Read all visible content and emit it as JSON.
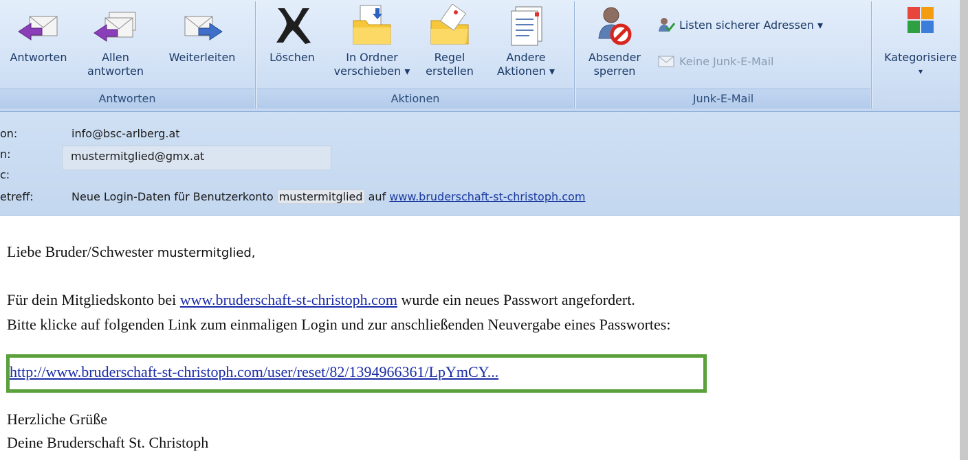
{
  "ribbon": {
    "groups": {
      "respond": {
        "caption": "Antworten"
      },
      "actions": {
        "caption": "Aktionen"
      },
      "junk": {
        "caption": "Junk-E-Mail"
      }
    },
    "reply_line1": "Antworten",
    "reply_all_line1": "Allen",
    "reply_all_line2": "antworten",
    "forward_line1": "Weiterleiten",
    "delete_line1": "Löschen",
    "move_line1": "In Ordner",
    "move_line2": "verschieben ▾",
    "rule_line1": "Regel",
    "rule_line2": "erstellen",
    "other_line1": "Andere",
    "other_line2": "Aktionen ▾",
    "block_line1": "Absender",
    "block_line2": "sperren",
    "safe_lists": "Listen sicherer Adressen ▾",
    "not_junk": "Keine Junk-E-Mail",
    "categorize_line1": "Kategorisiere",
    "categorize_line2": "▾",
    "icons": {
      "reply": "reply-envelope-icon",
      "reply_all": "reply-all-envelope-icon",
      "forward": "forward-envelope-icon",
      "delete": "delete-x-icon",
      "move": "move-to-folder-icon",
      "rule": "create-rule-icon",
      "other": "other-actions-icon",
      "block": "block-sender-icon",
      "safe_lists": "safe-senders-icon",
      "not_junk": "not-junk-icon",
      "categorize": "categorize-icon"
    }
  },
  "header": {
    "from_label": "on:",
    "from_value": "info@bsc-arlberg.at",
    "to_label": "n:",
    "to_value": "mustermitglied@gmx.at",
    "cc_label": "c:",
    "subject_label": "etreff:",
    "subject_prefix": "Neue Login-Daten für Benutzerkonto",
    "subject_token": "mustermitglied",
    "subject_mid": "auf",
    "subject_link": "www.bruderschaft-st-christoph.com"
  },
  "body": {
    "greeting": "Liebe Bruder/Schwester",
    "greeting_name": "mustermitglied,",
    "line1_prefix": "Für dein Mitgliedskonto bei",
    "line1_link": "www.bruderschaft-st-christoph.com",
    "line1_suffix": "wurde ein neues Passwort angefordert.",
    "line2": "Bitte klicke auf folgenden Link zum einmaligen Login und zur anschließenden Neuvergabe eines Passwortes:",
    "reset_link": "http://www.bruderschaft-st-christoph.com/user/reset/82/1394966361/LpYmCY...",
    "closing1": "Herzliche Grüße",
    "closing2": "Deine Bruderschaft St. Christoph"
  },
  "colors": {
    "ribbon_text": "#1b3a68",
    "highlight_box": "#5aa13c",
    "link": "#1a2ba6"
  }
}
